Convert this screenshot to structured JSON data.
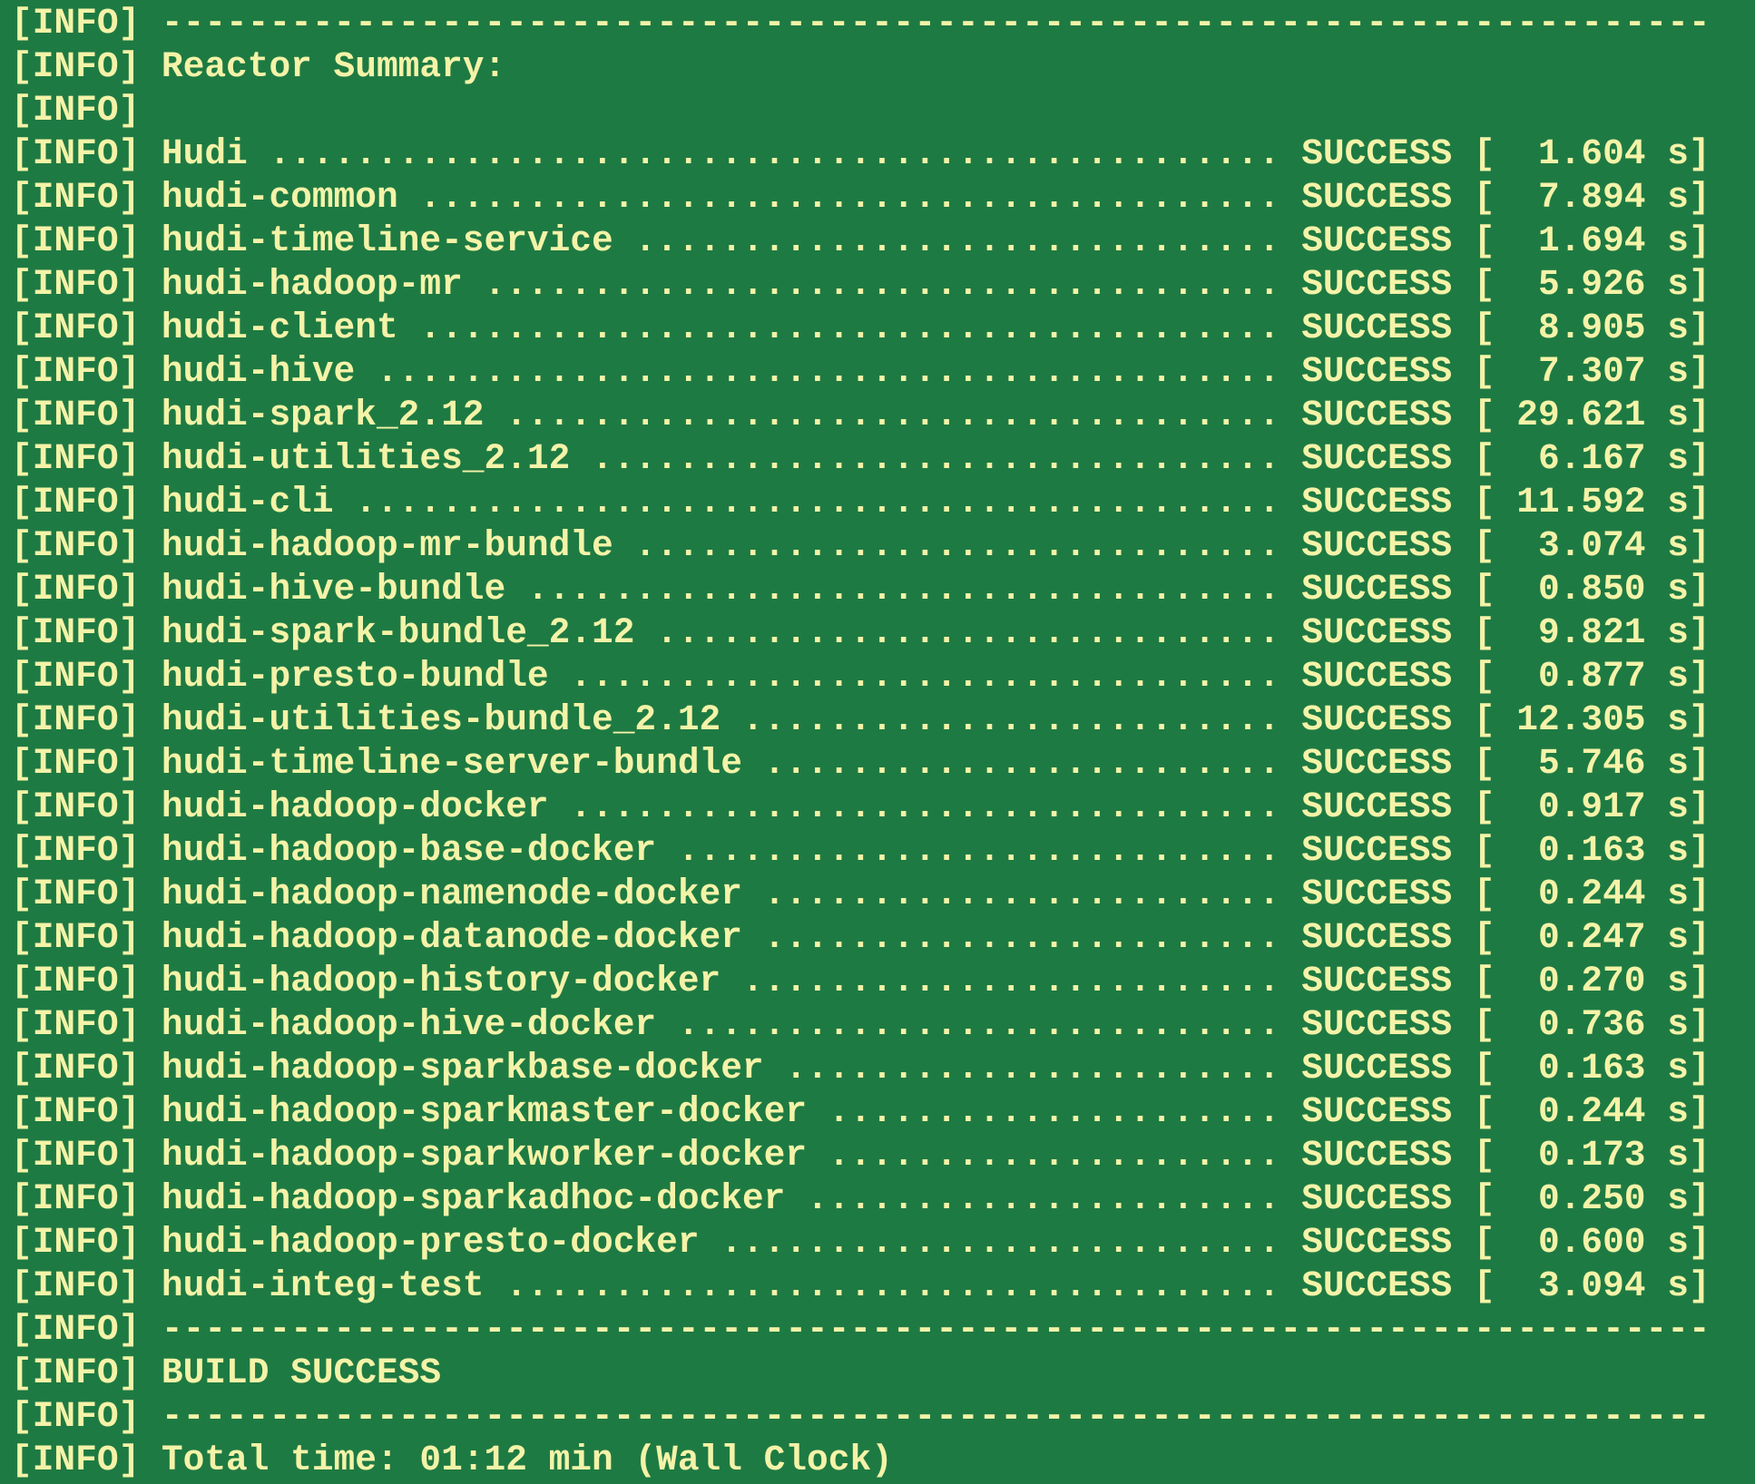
{
  "terminal": {
    "colors": {
      "background": "#1e7a43",
      "foreground": "#f4f3a8"
    },
    "lines": [
      "[INFO] ------------------------------------------------------------------------",
      "[INFO] Reactor Summary:",
      "[INFO]",
      "[INFO] Hudi ............................................... SUCCESS [  1.604 s]",
      "[INFO] hudi-common ........................................ SUCCESS [  7.894 s]",
      "[INFO] hudi-timeline-service .............................. SUCCESS [  1.694 s]",
      "[INFO] hudi-hadoop-mr ..................................... SUCCESS [  5.926 s]",
      "[INFO] hudi-client ........................................ SUCCESS [  8.905 s]",
      "[INFO] hudi-hive .......................................... SUCCESS [  7.307 s]",
      "[INFO] hudi-spark_2.12 .................................... SUCCESS [ 29.621 s]",
      "[INFO] hudi-utilities_2.12 ................................ SUCCESS [  6.167 s]",
      "[INFO] hudi-cli ........................................... SUCCESS [ 11.592 s]",
      "[INFO] hudi-hadoop-mr-bundle .............................. SUCCESS [  3.074 s]",
      "[INFO] hudi-hive-bundle ................................... SUCCESS [  0.850 s]",
      "[INFO] hudi-spark-bundle_2.12 ............................. SUCCESS [  9.821 s]",
      "[INFO] hudi-presto-bundle ................................. SUCCESS [  0.877 s]",
      "[INFO] hudi-utilities-bundle_2.12 ......................... SUCCESS [ 12.305 s]",
      "[INFO] hudi-timeline-server-bundle ........................ SUCCESS [  5.746 s]",
      "[INFO] hudi-hadoop-docker ................................. SUCCESS [  0.917 s]",
      "[INFO] hudi-hadoop-base-docker ............................ SUCCESS [  0.163 s]",
      "[INFO] hudi-hadoop-namenode-docker ........................ SUCCESS [  0.244 s]",
      "[INFO] hudi-hadoop-datanode-docker ........................ SUCCESS [  0.247 s]",
      "[INFO] hudi-hadoop-history-docker ......................... SUCCESS [  0.270 s]",
      "[INFO] hudi-hadoop-hive-docker ............................ SUCCESS [  0.736 s]",
      "[INFO] hudi-hadoop-sparkbase-docker ....................... SUCCESS [  0.163 s]",
      "[INFO] hudi-hadoop-sparkmaster-docker ..................... SUCCESS [  0.244 s]",
      "[INFO] hudi-hadoop-sparkworker-docker ..................... SUCCESS [  0.173 s]",
      "[INFO] hudi-hadoop-sparkadhoc-docker ...................... SUCCESS [  0.250 s]",
      "[INFO] hudi-hadoop-presto-docker .......................... SUCCESS [  0.600 s]",
      "[INFO] hudi-integ-test .................................... SUCCESS [  3.094 s]",
      "[INFO] ------------------------------------------------------------------------",
      "[INFO] BUILD SUCCESS",
      "[INFO] ------------------------------------------------------------------------",
      "[INFO] Total time: 01:12 min (Wall Clock)"
    ]
  }
}
